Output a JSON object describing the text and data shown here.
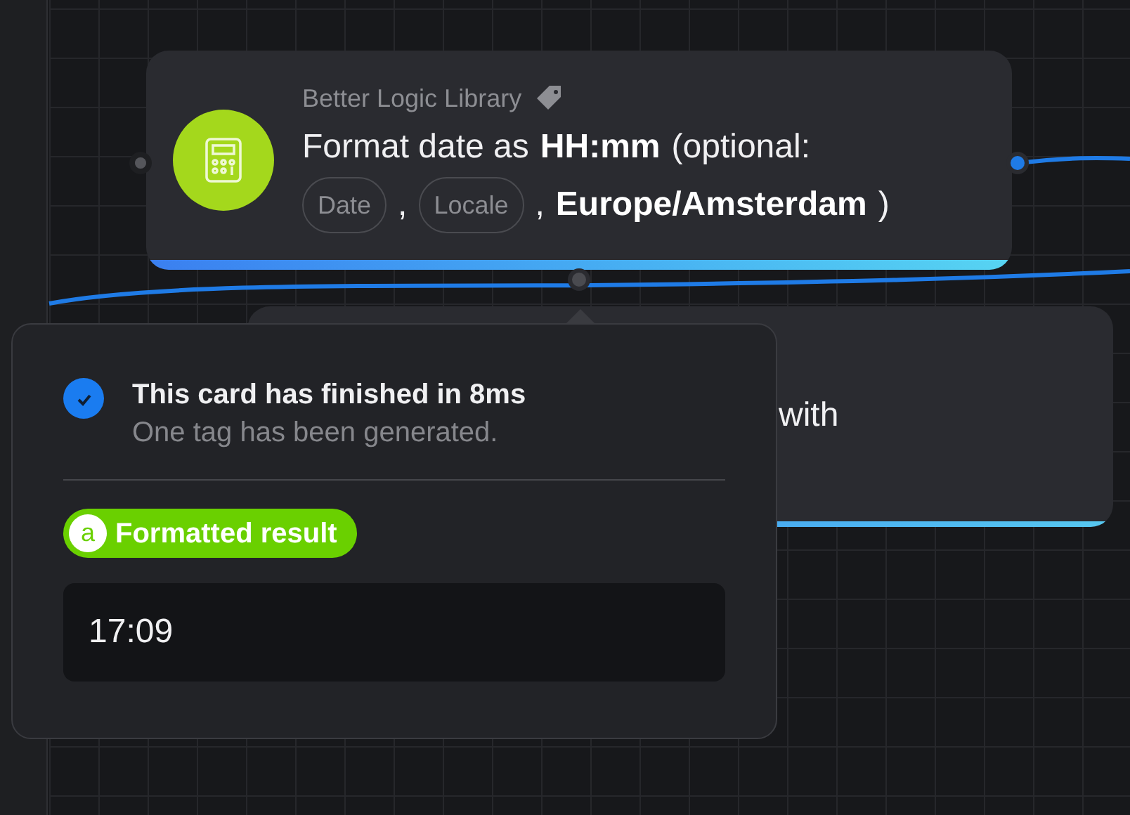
{
  "card": {
    "app": "Better Logic Library",
    "title_lines": [
      [
        {
          "kind": "text",
          "text": "Format date as"
        },
        {
          "kind": "bold",
          "text": "HH:mm"
        },
        {
          "kind": "text",
          "text": "(optional:"
        }
      ],
      [
        {
          "kind": "pill",
          "text": "Date"
        },
        {
          "kind": "text",
          "text": ","
        },
        {
          "kind": "pill",
          "text": "Locale"
        },
        {
          "kind": "text",
          "text": ","
        },
        {
          "kind": "bold",
          "text": "Europe/Amsterdam"
        },
        {
          "kind": "text",
          "text": ")"
        }
      ]
    ]
  },
  "behind_card": {
    "text": "with"
  },
  "result_popover": {
    "finished": true,
    "heading": "This card has finished in 8ms",
    "subtext": "One tag has been generated.",
    "token": {
      "letter": "a",
      "label": "Formatted result"
    },
    "value": "17:09"
  }
}
